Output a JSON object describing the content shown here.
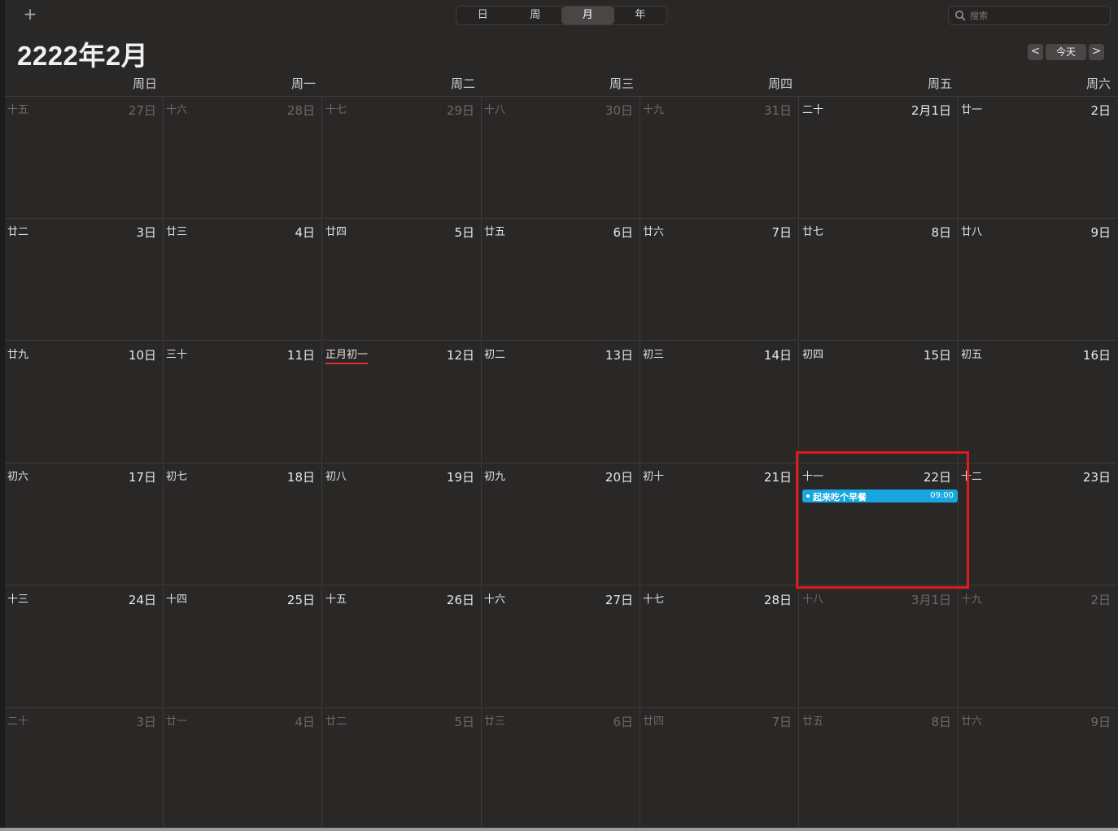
{
  "toolbar": {
    "add_label": "+",
    "views": [
      "日",
      "周",
      "月",
      "年"
    ],
    "active_view_index": 2,
    "search_placeholder": "搜索"
  },
  "header": {
    "title": "2222年2月",
    "prev_label": "<",
    "today_label": "今天",
    "next_label": ">"
  },
  "weekdays": [
    "周日",
    "周一",
    "周二",
    "周三",
    "周四",
    "周五",
    "周六"
  ],
  "weeks": [
    [
      {
        "lunar": "十五",
        "day": "27日",
        "dim": true
      },
      {
        "lunar": "十六",
        "day": "28日",
        "dim": true
      },
      {
        "lunar": "十七",
        "day": "29日",
        "dim": true
      },
      {
        "lunar": "十八",
        "day": "30日",
        "dim": true
      },
      {
        "lunar": "十九",
        "day": "31日",
        "dim": true
      },
      {
        "lunar": "二十",
        "day": "2月1日",
        "dim": false
      },
      {
        "lunar": "廿一",
        "day": "2日",
        "dim": false
      }
    ],
    [
      {
        "lunar": "廿二",
        "day": "3日",
        "dim": false
      },
      {
        "lunar": "廿三",
        "day": "4日",
        "dim": false
      },
      {
        "lunar": "廿四",
        "day": "5日",
        "dim": false
      },
      {
        "lunar": "廿五",
        "day": "6日",
        "dim": false
      },
      {
        "lunar": "廿六",
        "day": "7日",
        "dim": false
      },
      {
        "lunar": "廿七",
        "day": "8日",
        "dim": false
      },
      {
        "lunar": "廿八",
        "day": "9日",
        "dim": false
      }
    ],
    [
      {
        "lunar": "廿九",
        "day": "10日",
        "dim": false
      },
      {
        "lunar": "三十",
        "day": "11日",
        "dim": false
      },
      {
        "lunar": "正月初一",
        "day": "12日",
        "dim": false,
        "festival": true
      },
      {
        "lunar": "初二",
        "day": "13日",
        "dim": false
      },
      {
        "lunar": "初三",
        "day": "14日",
        "dim": false
      },
      {
        "lunar": "初四",
        "day": "15日",
        "dim": false
      },
      {
        "lunar": "初五",
        "day": "16日",
        "dim": false
      }
    ],
    [
      {
        "lunar": "初六",
        "day": "17日",
        "dim": false
      },
      {
        "lunar": "初七",
        "day": "18日",
        "dim": false
      },
      {
        "lunar": "初八",
        "day": "19日",
        "dim": false
      },
      {
        "lunar": "初九",
        "day": "20日",
        "dim": false
      },
      {
        "lunar": "初十",
        "day": "21日",
        "dim": false
      },
      {
        "lunar": "十一",
        "day": "22日",
        "dim": false,
        "event": {
          "title": "起来吃个早餐",
          "time": "09:00"
        }
      },
      {
        "lunar": "十二",
        "day": "23日",
        "dim": false
      }
    ],
    [
      {
        "lunar": "十三",
        "day": "24日",
        "dim": false
      },
      {
        "lunar": "十四",
        "day": "25日",
        "dim": false
      },
      {
        "lunar": "十五",
        "day": "26日",
        "dim": false
      },
      {
        "lunar": "十六",
        "day": "27日",
        "dim": false
      },
      {
        "lunar": "十七",
        "day": "28日",
        "dim": false
      },
      {
        "lunar": "十八",
        "day": "3月1日",
        "dim": true
      },
      {
        "lunar": "十九",
        "day": "2日",
        "dim": true
      }
    ],
    [
      {
        "lunar": "二十",
        "day": "3日",
        "dim": true
      },
      {
        "lunar": "廿一",
        "day": "4日",
        "dim": true
      },
      {
        "lunar": "廿二",
        "day": "5日",
        "dim": true
      },
      {
        "lunar": "廿三",
        "day": "6日",
        "dim": true
      },
      {
        "lunar": "廿四",
        "day": "7日",
        "dim": true
      },
      {
        "lunar": "廿五",
        "day": "8日",
        "dim": true
      },
      {
        "lunar": "廿六",
        "day": "9日",
        "dim": true
      }
    ]
  ],
  "colors": {
    "event": "#17a6df",
    "highlight": "#e01a1a",
    "festival_underline": "#e0302a"
  }
}
